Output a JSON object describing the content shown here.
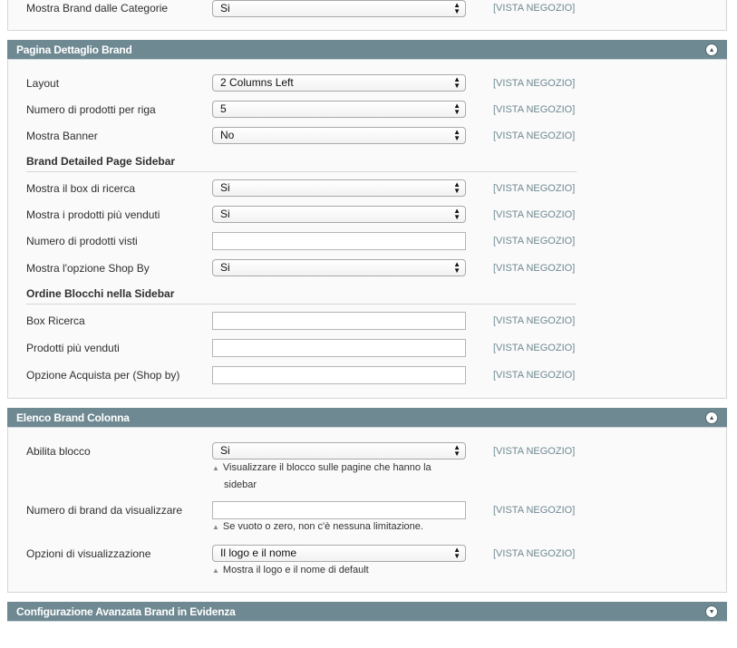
{
  "scope_label": "[VISTA NEGOZIO]",
  "top_row": {
    "label": "Mostra Brand dalle Categorie",
    "value": "Si"
  },
  "section1": {
    "title": "Pagina Dettaglio Brand",
    "layout": {
      "label": "Layout",
      "value": "2 Columns Left"
    },
    "per_row": {
      "label": "Numero di prodotti per riga",
      "value": "5"
    },
    "banner": {
      "label": "Mostra Banner",
      "value": "No"
    },
    "sidebar_heading": "Brand Detailed Page Sidebar",
    "search_box": {
      "label": "Mostra il box di ricerca",
      "value": "Si"
    },
    "bestsellers": {
      "label": "Mostra i prodotti più venduti",
      "value": "Si"
    },
    "viewed": {
      "label": "Numero di prodotti visti",
      "value": ""
    },
    "shop_by": {
      "label": "Mostra l'opzione Shop By",
      "value": "Si"
    },
    "order_heading": "Ordine Blocchi nella Sidebar",
    "order_search": {
      "label": "Box Ricerca",
      "value": ""
    },
    "order_bestsellers": {
      "label": "Prodotti più venduti",
      "value": ""
    },
    "order_shopby": {
      "label": "Opzione Acquista per (Shop by)",
      "value": ""
    }
  },
  "section2": {
    "title": "Elenco Brand Colonna",
    "enable": {
      "label": "Abilita blocco",
      "value": "Si",
      "note_line1": "Visualizzare il blocco sulle pagine che hanno la",
      "note_line2": "sidebar"
    },
    "count": {
      "label": "Numero di brand da visualizzare",
      "value": "",
      "note": "Se vuoto o zero, non c'è nessuna limitazione."
    },
    "display": {
      "label": "Opzioni di visualizzazione",
      "value": "Il logo e il nome",
      "note": "Mostra il logo e il nome di default"
    }
  },
  "section3": {
    "title": "Configurazione Avanzata Brand in Evidenza"
  },
  "colors": {
    "header_bg": "#6f8992",
    "scope_text": "#6f8992",
    "panel_bg": "#fafafa"
  },
  "icons": {
    "collapse": "collapse-up-icon",
    "expand": "expand-down-icon"
  }
}
